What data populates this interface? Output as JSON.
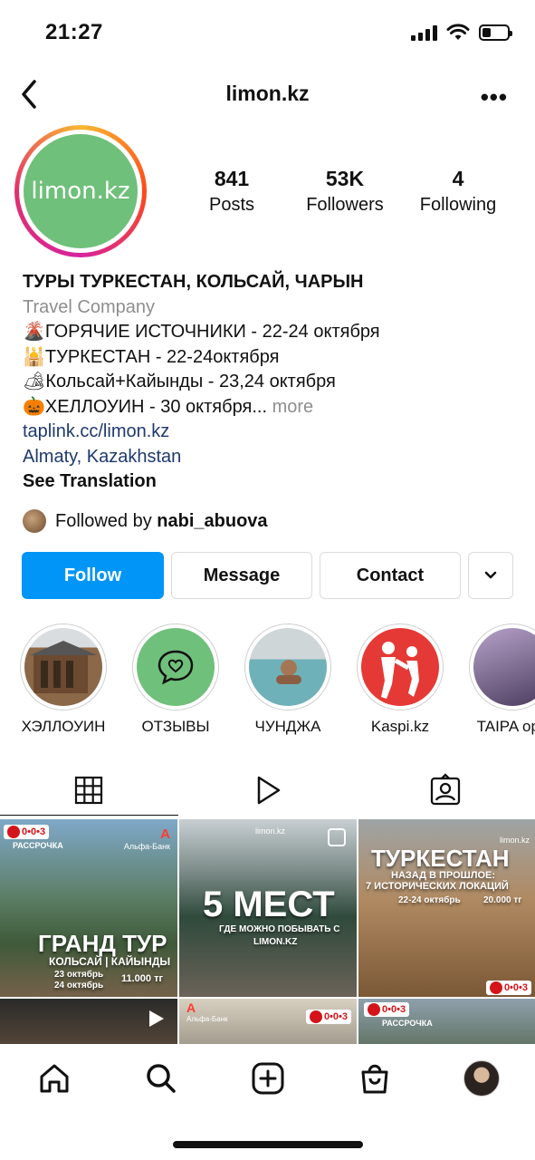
{
  "status_bar": {
    "time": "21:27"
  },
  "header": {
    "username": "limon.kz"
  },
  "profile": {
    "avatar_text": "limon.kz",
    "stats": [
      {
        "value": "841",
        "label": "Posts"
      },
      {
        "value": "53K",
        "label": "Followers"
      },
      {
        "value": "4",
        "label": "Following"
      }
    ]
  },
  "bio": {
    "name": "ТУРЫ ТУРКЕСТАН, КОЛЬСАЙ, ЧАРЫН",
    "category": "Travel Company",
    "lines": [
      {
        "emoji": "🌋",
        "text": "ГОРЯЧИЕ ИСТОЧНИКИ - 22-24 октября"
      },
      {
        "emoji": "🕌",
        "text": "ТУРКЕСТАН - 22-24октября"
      },
      {
        "emoji": "🏕",
        "text": "Кольсай+Кайынды - 23,24 октября"
      },
      {
        "emoji": "🎃",
        "text": "ХЕЛЛОУИН - 30 октября..."
      }
    ],
    "more": "more",
    "link": "taplink.cc/limon.kz",
    "location": "Almaty, Kazakhstan",
    "see_translation": "See Translation"
  },
  "followed_by": {
    "prefix": "Followed by",
    "user": "nabi_abuova"
  },
  "buttons": {
    "follow": "Follow",
    "message": "Message",
    "contact": "Contact"
  },
  "highlights": [
    {
      "label": "ХЭЛЛОУИН"
    },
    {
      "label": "ОТЗЫВЫ"
    },
    {
      "label": "ЧУНДЖА"
    },
    {
      "label": "Kaspi.kz"
    },
    {
      "label": "TAIPA ope"
    }
  ],
  "posts": {
    "p1": {
      "badge": "0•0•3",
      "badge_sub": "РАССРОЧКА",
      "bank": "Альфа-Банк",
      "title": "ГРАНД ТУР",
      "subtitle": "КОЛЬСАЙ | КАЙЫНДЫ",
      "dates1": "23 октябрь",
      "dates2": "24 октябрь",
      "price": "11.000 тг"
    },
    "p2": {
      "brand": "limon.kz",
      "title": "5 МЕСТ",
      "subtitle1": "ГДЕ МОЖНО ПОБЫВАТЬ С",
      "subtitle2": "LIMON.KZ"
    },
    "p3": {
      "brand": "limon.kz",
      "title": "ТУРКЕСТАН",
      "subtitle1": "НАЗАД В ПРОШЛОЕ:",
      "subtitle2": "7 ИСТОРИЧЕСКИХ ЛОКАЦИЙ",
      "dates": "22-24 октябрь",
      "price": "20.000 тг",
      "badge": "0•0•3"
    },
    "p5": {
      "bank": "Альфа-Банк",
      "badge": "0•0•3"
    },
    "p6": {
      "badge": "0•0•3",
      "badge_sub": "РАССРОЧКА"
    }
  },
  "colors": {
    "follow_blue": "#0095f6",
    "avatar_green": "#6fc07a",
    "alfa_red": "#d3151b"
  }
}
